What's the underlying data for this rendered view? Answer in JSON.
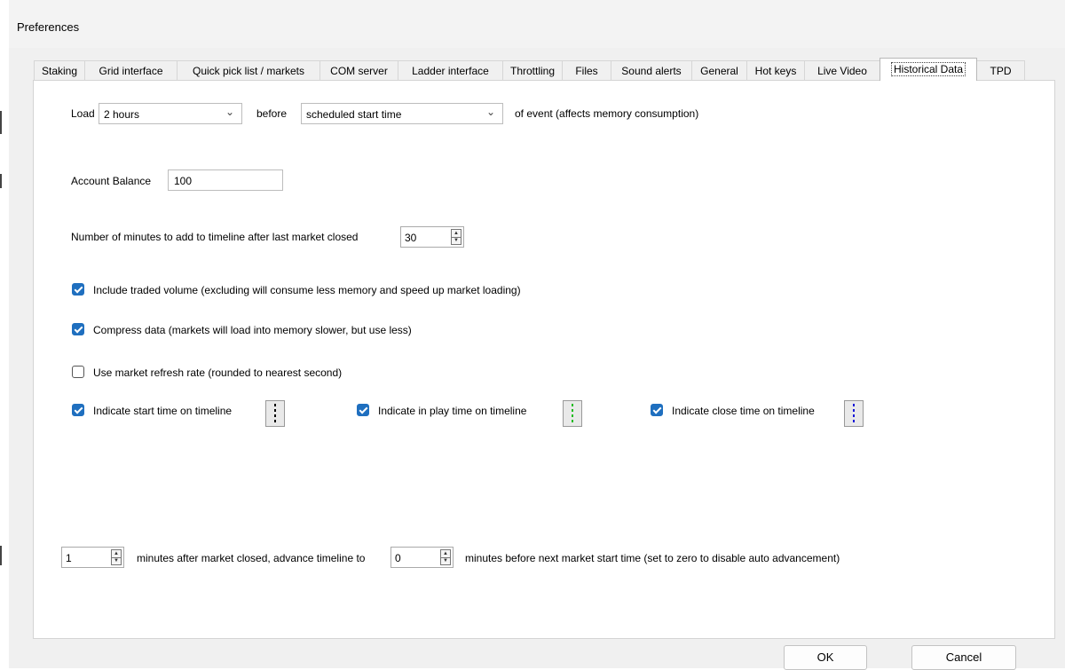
{
  "window": {
    "title": "Preferences"
  },
  "tabs": [
    {
      "label": "Staking"
    },
    {
      "label": "Grid interface"
    },
    {
      "label": "Quick pick list / markets"
    },
    {
      "label": "COM server"
    },
    {
      "label": "Ladder interface"
    },
    {
      "label": "Throttling"
    },
    {
      "label": "Files"
    },
    {
      "label": "Sound alerts"
    },
    {
      "label": "General"
    },
    {
      "label": "Hot keys"
    },
    {
      "label": "Live Video"
    },
    {
      "label": "Historical Data"
    },
    {
      "label": "TPD"
    }
  ],
  "active_tab": "Historical Data",
  "load": {
    "label": "Load",
    "duration_value": "2 hours",
    "before_label": "before",
    "reference_value": "scheduled start time",
    "suffix": "of event (affects memory consumption)"
  },
  "account_balance": {
    "label": "Account Balance",
    "value": "100"
  },
  "timeline_minutes": {
    "label": "Number of minutes to add to timeline after last market closed",
    "value": "30"
  },
  "options": {
    "include_traded_volume": {
      "label": "Include traded volume (excluding will consume less memory and speed up market loading)",
      "checked": true
    },
    "compress_data": {
      "label": "Compress data (markets will load into memory slower, but use less)",
      "checked": true
    },
    "market_refresh_rate": {
      "label": "Use market refresh rate (rounded to nearest second)",
      "checked": false
    }
  },
  "indicators": {
    "start": {
      "label": "Indicate start time on timeline",
      "checked": true,
      "color": "#000000"
    },
    "in_play": {
      "label": "Indicate in play time on timeline",
      "checked": true,
      "color": "#22bb22"
    },
    "close": {
      "label": "Indicate close time on timeline",
      "checked": true,
      "color": "#1a1ad6"
    }
  },
  "advance": {
    "after_value": "1",
    "after_label": "minutes after market closed, advance timeline to",
    "before_value": "0",
    "before_label": "minutes before next market start time (set to zero to disable auto advancement)"
  },
  "buttons": {
    "ok": "OK",
    "cancel": "Cancel"
  },
  "colors": {
    "accent": "#1f6fbf"
  }
}
